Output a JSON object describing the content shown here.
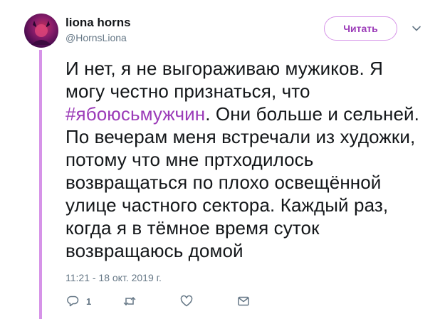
{
  "header": {
    "name": "liona horns",
    "handle": "@HornsLiona",
    "follow_label": "Читать"
  },
  "tweet": {
    "text_before": "И нет, я не выгораживаю мужиков. Я могу честно признаться, что ",
    "hashtag": "#ябоюсьмужчин",
    "text_after": ". Они больше и сельней. По вечерам меня встречали из художки, потому что мне пртходилось возвращаться по плохо освещённой улице частного сектора. Каждый раз, когда я в тёмное время суток возвращаюсь домой",
    "timestamp": "11:21 - 18 окт. 2019 г."
  },
  "actions": {
    "reply_count": "1",
    "icons": [
      "reply-icon",
      "retweet-icon",
      "like-icon",
      "message-icon"
    ]
  },
  "colors": {
    "accent": "#9b3bb8",
    "thread_line": "#d693e8",
    "secondary_text": "#657786"
  }
}
